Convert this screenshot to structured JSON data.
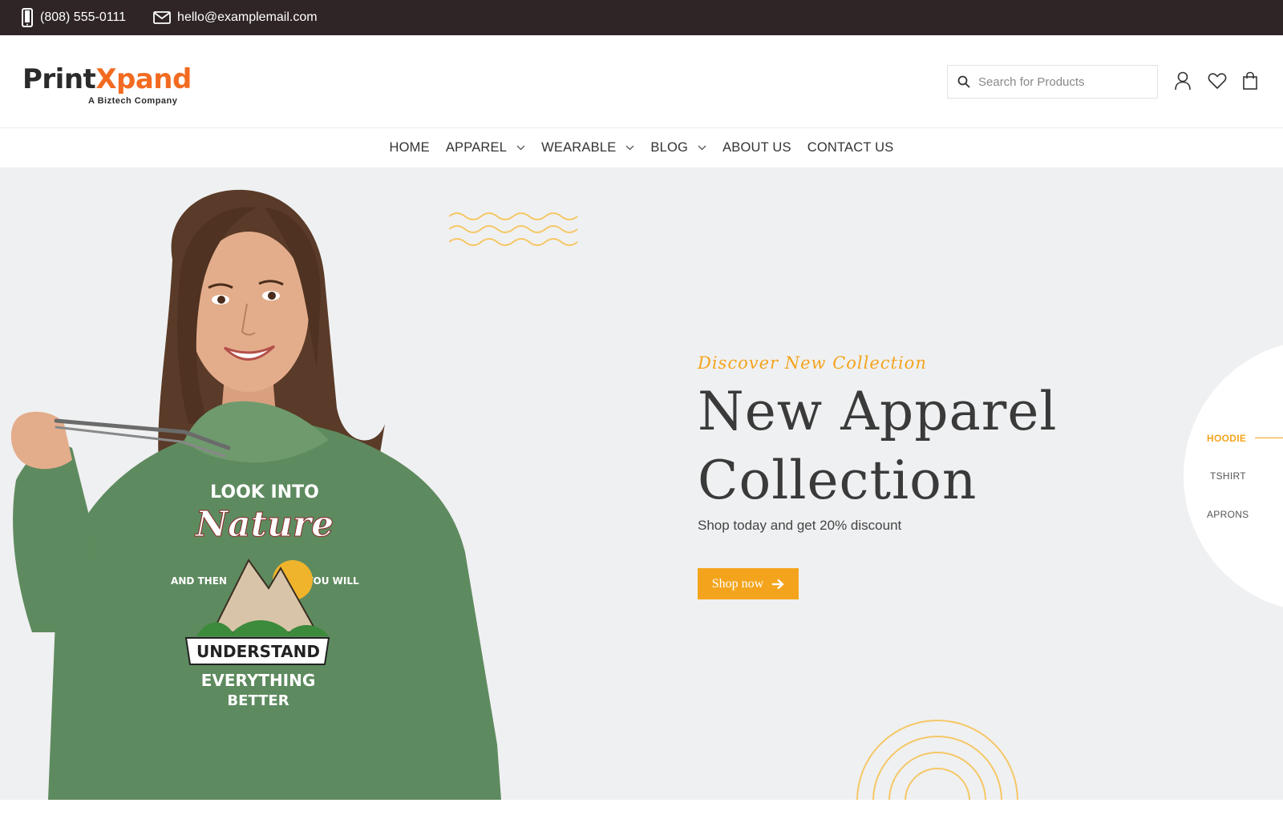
{
  "topbar": {
    "phone": "(808) 555-0111",
    "email": "hello@examplemail.com",
    "phone_icon": "phone-icon",
    "email_icon": "mail-icon"
  },
  "header": {
    "logo": {
      "part1": "Print",
      "part2": "Xpand",
      "tagline": "A Biztech Company"
    },
    "search": {
      "placeholder": "Search for Products",
      "value": ""
    },
    "icons": [
      "user-icon",
      "heart-icon",
      "shopping-bag-icon"
    ]
  },
  "nav": {
    "items": [
      {
        "label": "HOME",
        "dropdown": false
      },
      {
        "label": "APPAREL",
        "dropdown": true
      },
      {
        "label": "WEARABLE",
        "dropdown": true
      },
      {
        "label": "BLOG",
        "dropdown": true
      },
      {
        "label": "ABOUT US",
        "dropdown": false
      },
      {
        "label": "CONTACT US",
        "dropdown": false
      }
    ]
  },
  "hero": {
    "eyebrow": "Discover New Collection",
    "headline_line1": "New Apparel",
    "headline_line2": "Collection",
    "subtext": "Shop today and get 20% discount",
    "cta_label": "Shop now",
    "cta_icon": "arrow-right-icon",
    "model_shirt_text": {
      "line1": "LOOK INTO",
      "line2": "Nature",
      "left": "AND THEN",
      "right": "YOU WILL",
      "banner": "UNDERSTAND",
      "line5": "EVERYTHING",
      "line6": "BETTER"
    }
  },
  "categories": {
    "items": [
      {
        "label": "HOODIE",
        "active": true
      },
      {
        "label": "TSHIRT",
        "active": false
      },
      {
        "label": "APRONS",
        "active": false
      }
    ]
  },
  "colors": {
    "topbar_bg": "#2f2526",
    "accent": "#f4a41c",
    "logo_orange": "#f26b21",
    "hero_bg": "#eff0f1",
    "hoodie_green": "#5e8a5f"
  }
}
